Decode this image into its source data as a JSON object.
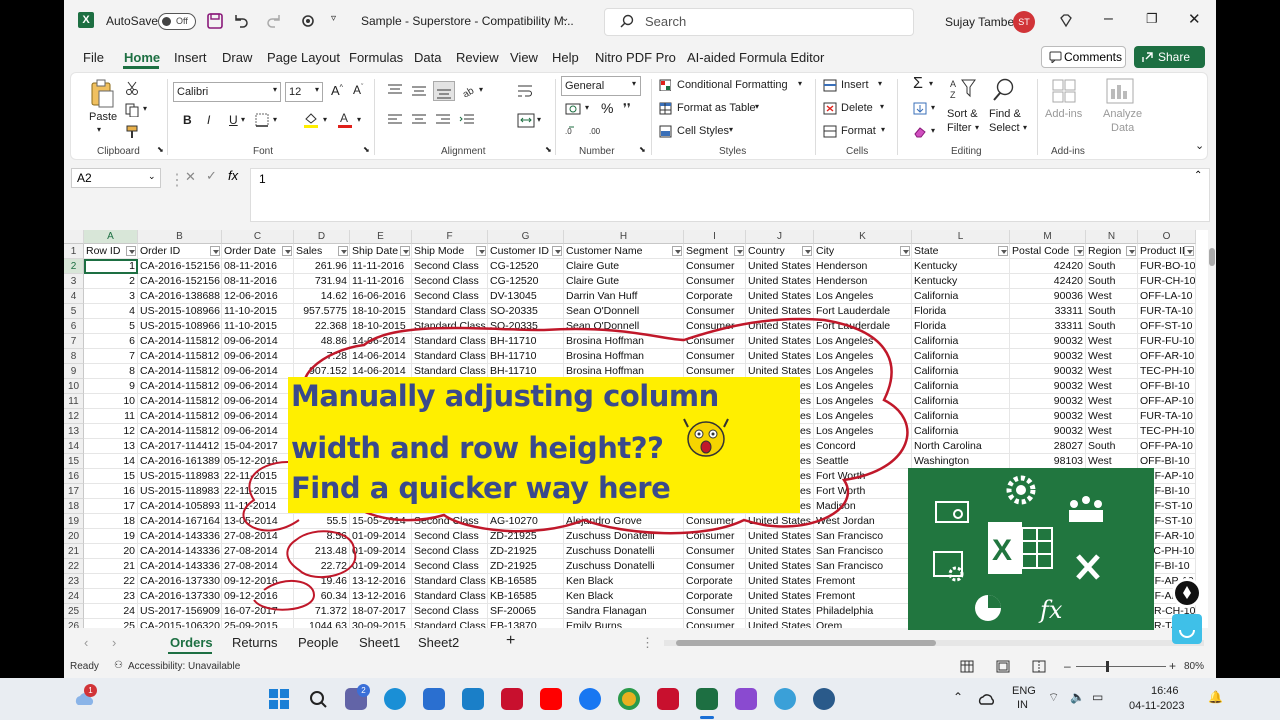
{
  "titlebar": {
    "autosave_label": "AutoSave",
    "autosave_state": "Off",
    "file_title": "Sample - Superstore  -  Compatibility M...",
    "search_placeholder": "Search",
    "user_name": "Sujay Tambe",
    "user_initials": "ST"
  },
  "menu": [
    "File",
    "Home",
    "Insert",
    "Draw",
    "Page Layout",
    "Formulas",
    "Data",
    "Review",
    "View",
    "Help",
    "Nitro PDF Pro",
    "AI-aided Formula Editor"
  ],
  "actions": {
    "comments": "Comments",
    "share": "Share"
  },
  "ribbon": {
    "clipboard": {
      "paste": "Paste",
      "label": "Clipboard"
    },
    "font": {
      "name": "Calibri",
      "size": "12",
      "label": "Font",
      "bold": "B",
      "italic": "I",
      "underline": "U"
    },
    "alignment": {
      "label": "Alignment"
    },
    "number": {
      "format": "General",
      "label": "Number",
      "percent": "%"
    },
    "styles": {
      "conditional": "Conditional Formatting",
      "format_table": "Format as Table",
      "cell_styles": "Cell Styles",
      "label": "Styles"
    },
    "cells": {
      "insert": "Insert",
      "delete": "Delete",
      "format": "Format",
      "label": "Cells"
    },
    "editing": {
      "sort_filter": "Sort &",
      "sort_filter2": "Filter",
      "find_select": "Find &",
      "find_select2": "Select",
      "label": "Editing"
    },
    "addins": {
      "addins": "Add-ins",
      "analyze": "Analyze",
      "analyze2": "Data",
      "label": "Add-ins"
    }
  },
  "formula_bar": {
    "name_box": "A2",
    "fx": "fx",
    "value": "1"
  },
  "columns": [
    "A",
    "B",
    "C",
    "D",
    "E",
    "F",
    "G",
    "H",
    "I",
    "J",
    "K",
    "L",
    "M",
    "N",
    "O"
  ],
  "headers": [
    "Row ID",
    "Order ID",
    "Order Date",
    "Sales",
    "Ship Date",
    "Ship Mode",
    "Customer ID",
    "Customer Name",
    "Segment",
    "Country",
    "City",
    "State",
    "Postal Code",
    "Region",
    "Product ID"
  ],
  "rows": [
    [
      "1",
      "CA-2016-152156",
      "08-11-2016",
      "261.96",
      "11-11-2016",
      "Second Class",
      "CG-12520",
      "Claire Gute",
      "Consumer",
      "United States",
      "Henderson",
      "Kentucky",
      "42420",
      "South",
      "FUR-BO-10"
    ],
    [
      "2",
      "CA-2016-152156",
      "08-11-2016",
      "731.94",
      "11-11-2016",
      "Second Class",
      "CG-12520",
      "Claire Gute",
      "Consumer",
      "United States",
      "Henderson",
      "Kentucky",
      "42420",
      "South",
      "FUR-CH-10"
    ],
    [
      "3",
      "CA-2016-138688",
      "12-06-2016",
      "14.62",
      "16-06-2016",
      "Second Class",
      "DV-13045",
      "Darrin Van Huff",
      "Corporate",
      "United States",
      "Los Angeles",
      "California",
      "90036",
      "West",
      "OFF-LA-10"
    ],
    [
      "4",
      "US-2015-108966",
      "11-10-2015",
      "957.5775",
      "18-10-2015",
      "Standard Class",
      "SO-20335",
      "Sean O'Donnell",
      "Consumer",
      "United States",
      "Fort Lauderdale",
      "Florida",
      "33311",
      "South",
      "FUR-TA-10"
    ],
    [
      "5",
      "US-2015-108966",
      "11-10-2015",
      "22.368",
      "18-10-2015",
      "Standard Class",
      "SO-20335",
      "Sean O'Donnell",
      "Consumer",
      "United States",
      "Fort Lauderdale",
      "Florida",
      "33311",
      "South",
      "OFF-ST-10"
    ],
    [
      "6",
      "CA-2014-115812",
      "09-06-2014",
      "48.86",
      "14-06-2014",
      "Standard Class",
      "BH-11710",
      "Brosina Hoffman",
      "Consumer",
      "United States",
      "Los Angeles",
      "California",
      "90032",
      "West",
      "FUR-FU-10"
    ],
    [
      "7",
      "CA-2014-115812",
      "09-06-2014",
      "7.28",
      "14-06-2014",
      "Standard Class",
      "BH-11710",
      "Brosina Hoffman",
      "Consumer",
      "United States",
      "Los Angeles",
      "California",
      "90032",
      "West",
      "OFF-AR-10"
    ],
    [
      "8",
      "CA-2014-115812",
      "09-06-2014",
      "907.152",
      "14-06-2014",
      "Standard Class",
      "BH-11710",
      "Brosina Hoffman",
      "Consumer",
      "United States",
      "Los Angeles",
      "California",
      "90032",
      "West",
      "TEC-PH-10"
    ],
    [
      "9",
      "CA-2014-115812",
      "09-06-2014",
      "",
      "",
      "",
      "",
      "",
      "Consumer",
      "United States",
      "Los Angeles",
      "California",
      "90032",
      "West",
      "OFF-BI-10"
    ],
    [
      "10",
      "CA-2014-115812",
      "09-06-2014",
      "",
      "",
      "",
      "",
      "",
      "Consumer",
      "United States",
      "Los Angeles",
      "California",
      "90032",
      "West",
      "OFF-AP-10"
    ],
    [
      "11",
      "CA-2014-115812",
      "09-06-2014",
      "",
      "",
      "",
      "",
      "",
      "Consumer",
      "United States",
      "Los Angeles",
      "California",
      "90032",
      "West",
      "FUR-TA-10"
    ],
    [
      "12",
      "CA-2014-115812",
      "09-06-2014",
      "",
      "",
      "",
      "",
      "",
      "Consumer",
      "United States",
      "Los Angeles",
      "California",
      "90032",
      "West",
      "TEC-PH-10"
    ],
    [
      "13",
      "CA-2017-114412",
      "15-04-2017",
      "",
      "",
      "",
      "",
      "",
      "Consumer",
      "United States",
      "Concord",
      "North Carolina",
      "28027",
      "South",
      "OFF-PA-10"
    ],
    [
      "14",
      "CA-2016-161389",
      "05-12-2016",
      "",
      "",
      "",
      "",
      "",
      "Consumer",
      "United States",
      "Seattle",
      "Washington",
      "98103",
      "West",
      "OFF-BI-10"
    ],
    [
      "15",
      "US-2015-118983",
      "22-11-2015",
      "",
      "",
      "",
      "",
      "",
      "Home Office",
      "United States",
      "Fort Worth",
      "",
      "",
      "",
      "OFF-AP-10"
    ],
    [
      "16",
      "US-2015-118983",
      "22-11-2015",
      "",
      "",
      "",
      "",
      "",
      "Home Office",
      "United States",
      "Fort Worth",
      "",
      "",
      "",
      "OFF-BI-10"
    ],
    [
      "17",
      "CA-2014-105893",
      "11-11-2014",
      "",
      "",
      "",
      "",
      "",
      "Consumer",
      "United States",
      "Madison",
      "",
      "",
      "",
      "OFF-ST-10"
    ],
    [
      "18",
      "CA-2014-167164",
      "13-05-2014",
      "55.5",
      "15-05-2014",
      "Second Class",
      "AG-10270",
      "Alejandro Grove",
      "Consumer",
      "United States",
      "West Jordan",
      "",
      "",
      "",
      "OFF-ST-10"
    ],
    [
      "19",
      "CA-2014-143336",
      "27-08-2014",
      "8.56",
      "01-09-2014",
      "Second Class",
      "ZD-21925",
      "Zuschuss Donatelli",
      "Consumer",
      "United States",
      "San Francisco",
      "",
      "",
      "",
      "OFF-AR-10"
    ],
    [
      "20",
      "CA-2014-143336",
      "27-08-2014",
      "213.48",
      "01-09-2014",
      "Second Class",
      "ZD-21925",
      "Zuschuss Donatelli",
      "Consumer",
      "United States",
      "San Francisco",
      "",
      "",
      "",
      "TEC-PH-10"
    ],
    [
      "21",
      "CA-2014-143336",
      "27-08-2014",
      "22.72",
      "01-09-2014",
      "Second Class",
      "ZD-21925",
      "Zuschuss Donatelli",
      "Consumer",
      "United States",
      "San Francisco",
      "",
      "",
      "",
      "OFF-BI-10"
    ],
    [
      "22",
      "CA-2016-137330",
      "09-12-2016",
      "19.46",
      "13-12-2016",
      "Standard Class",
      "KB-16585",
      "Ken Black",
      "Corporate",
      "United States",
      "Fremont",
      "",
      "",
      "",
      "OFF-AP-10"
    ],
    [
      "23",
      "CA-2016-137330",
      "09-12-2016",
      "60.34",
      "13-12-2016",
      "Standard Class",
      "KB-16585",
      "Ken Black",
      "Corporate",
      "United States",
      "Fremont",
      "",
      "",
      "",
      "OFF-AP-10"
    ],
    [
      "24",
      "US-2017-156909",
      "16-07-2017",
      "71.372",
      "18-07-2017",
      "Second Class",
      "SF-20065",
      "Sandra Flanagan",
      "Consumer",
      "United States",
      "Philadelphia",
      "",
      "",
      "",
      "FUR-CH-10"
    ],
    [
      "25",
      "CA-2015-106320",
      "25-09-2015",
      "1044.63",
      "30-09-2015",
      "Standard Class",
      "EB-13870",
      "Emily Burns",
      "Consumer",
      "United States",
      "Orem",
      "",
      "",
      "",
      "FUR-TA-10"
    ]
  ],
  "sheets": [
    "Orders",
    "Returns",
    "People",
    "Sheet1",
    "Sheet2"
  ],
  "status": {
    "ready": "Ready",
    "accessibility": "Accessibility: Unavailable",
    "zoom": "80%"
  },
  "banner": {
    "line1": "Manually adjusting column",
    "line2": "width and row height??",
    "line3": "Find a quicker way here"
  },
  "taskbar": {
    "lang1": "ENG",
    "lang2": "IN",
    "time": "16:46",
    "date": "04-11-2023",
    "weather_badge": "1",
    "chat_badge": "2"
  },
  "colors": {
    "excel_green": "#1d6f42",
    "banner_yellow": "#ffef00",
    "banner_text": "#3a4a8c",
    "annotation_red": "#c0182a"
  }
}
